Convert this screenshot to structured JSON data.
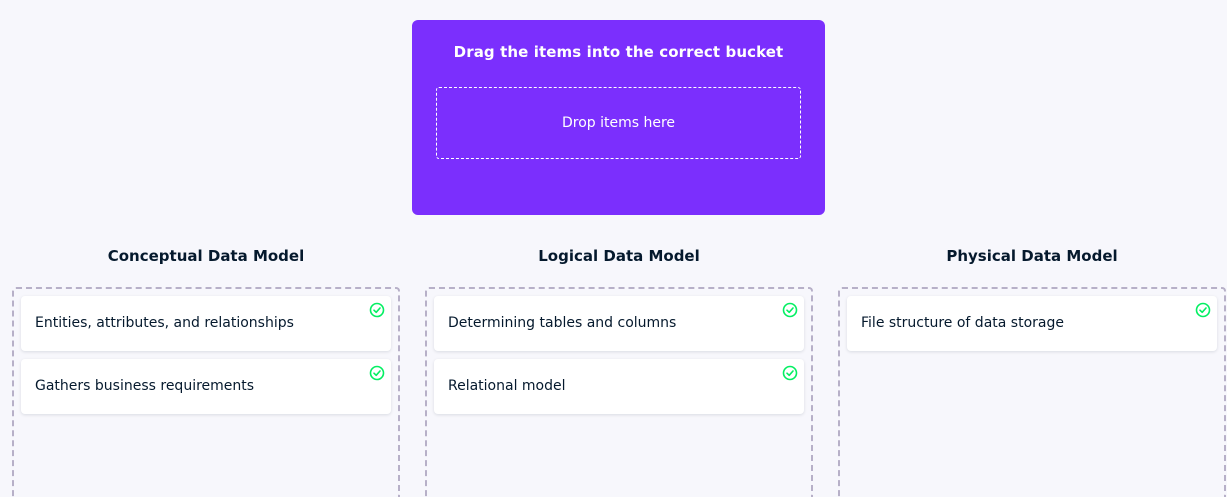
{
  "source": {
    "title": "Drag the items into the correct bucket",
    "drop_text": "Drop items here",
    "background_color": "#7b2ffd"
  },
  "buckets": [
    {
      "title": "Conceptual Data Model",
      "items": [
        {
          "label": "Entities, attributes, and relationships",
          "status": "correct",
          "icon": "check-circle-icon"
        },
        {
          "label": "Gathers business requirements",
          "status": "correct",
          "icon": "check-circle-icon"
        }
      ]
    },
    {
      "title": "Logical Data Model",
      "items": [
        {
          "label": "Determining tables and columns",
          "status": "correct",
          "icon": "check-circle-icon"
        },
        {
          "label": "Relational model",
          "status": "correct",
          "icon": "check-circle-icon"
        }
      ]
    },
    {
      "title": "Physical Data Model",
      "items": [
        {
          "label": "File structure of data storage",
          "status": "correct",
          "icon": "check-circle-icon"
        }
      ]
    }
  ],
  "colors": {
    "correct": "#03ef62",
    "page_background": "#f7f7fc"
  }
}
